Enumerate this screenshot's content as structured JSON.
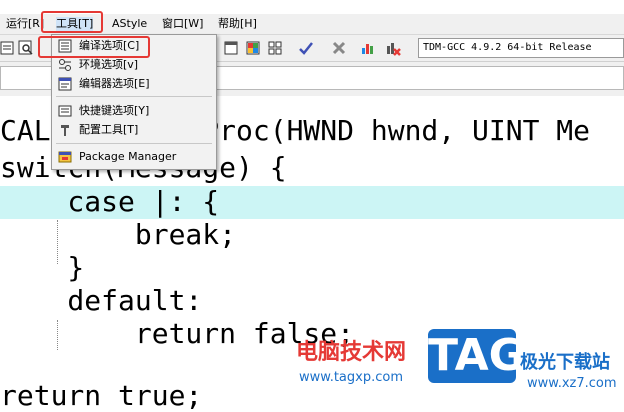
{
  "menubar": {
    "items": [
      {
        "label": "运行[R]"
      },
      {
        "label": "工具[T]"
      },
      {
        "label": "AStyle"
      },
      {
        "label": "窗口[W]"
      },
      {
        "label": "帮助[H]"
      }
    ]
  },
  "toolbar": {
    "compiler": "TDM-GCC 4.9.2 64-bit Release"
  },
  "tools_menu": {
    "items": [
      {
        "label": "编译选项[C]",
        "icon": "compiler-options-icon"
      },
      {
        "label": "环境选项[v]",
        "icon": "environment-options-icon"
      },
      {
        "label": "编辑器选项[E]",
        "icon": "editor-options-icon"
      },
      {
        "label": "快捷键选项[Y]",
        "icon": "shortcut-options-icon"
      },
      {
        "label": "配置工具[T]",
        "icon": "configure-tools-icon"
      },
      {
        "label": "Package Manager",
        "icon": "package-manager-icon"
      }
    ]
  },
  "editor": {
    "lines": [
      "CALLBACK WndProc(HWND hwnd, UINT Me",
      "switch(Message) {",
      "    case |: {",
      "        break;",
      "    }",
      "    default:",
      "        return false;",
      "return true;"
    ]
  },
  "watermark": {
    "site_cn": "电脑技术网",
    "site_url": "www.tagxp.com",
    "logo": "TAG",
    "site2_cn": "极光下载站",
    "site2_url": "www.xz7.com"
  },
  "colors": {
    "highlight": "#ccf5f5",
    "annotation": "#e53935",
    "brand_blue": "#1a6fc8"
  }
}
